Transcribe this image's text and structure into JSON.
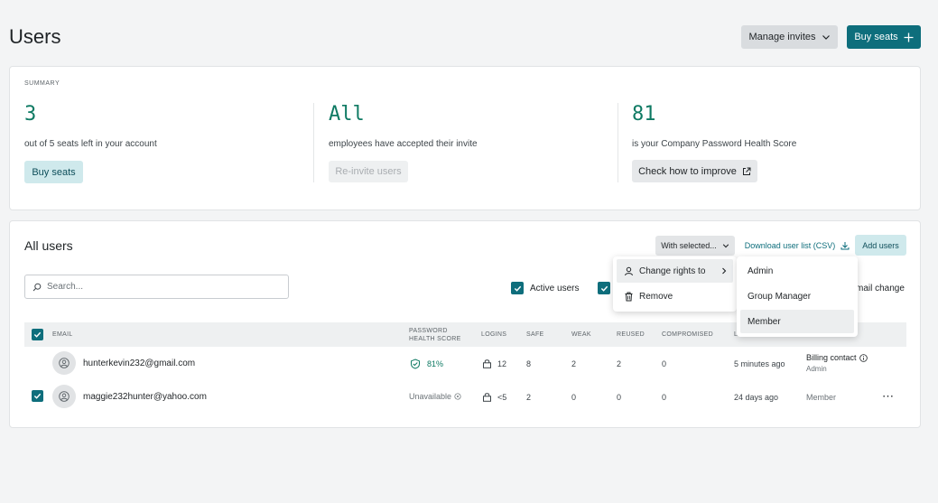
{
  "header": {
    "title": "Users",
    "manage_invites_label": "Manage invites",
    "buy_seats_label": "Buy seats"
  },
  "summary": {
    "label": "SUMMARY",
    "seats": {
      "value": "3",
      "text": "out of 5 seats left in your account",
      "button": "Buy seats"
    },
    "invites": {
      "value": "All",
      "text": "employees have accepted their invite",
      "button": "Re-invite users"
    },
    "health": {
      "value": "81",
      "text": "is your Company Password Health Score",
      "button": "Check how to improve"
    }
  },
  "all_users": {
    "title": "All users",
    "with_selected_label": "With selected...",
    "download_label": "Download user list (CSV)",
    "add_users_label": "Add users",
    "search_placeholder": "Search...",
    "filter_active_label": "Active users",
    "filter_email_change_label": "mail change",
    "columns": {
      "email": "EMAIL",
      "phs_line1": "PASSWORD",
      "phs_line2": "HEALTH SCORE",
      "logins": "LOGINS",
      "safe": "SAFE",
      "weak": "WEAK",
      "reused": "REUSED",
      "compromised": "COMPROMISED",
      "last_login": "L"
    },
    "rows": [
      {
        "email": "hunterkevin232@gmail.com",
        "health_score": "81%",
        "logins": "12",
        "safe": "8",
        "weak": "2",
        "reused": "2",
        "compromised": "0",
        "last_login": "5 minutes ago",
        "role_primary": "Billing contact",
        "role_secondary": "Admin"
      },
      {
        "email": "maggie232hunter@yahoo.com",
        "health_score": "Unavailable",
        "logins": "<5",
        "safe": "2",
        "weak": "0",
        "reused": "0",
        "compromised": "0",
        "last_login": "24 days ago",
        "role_primary": "Member",
        "more": "⋯"
      }
    ]
  },
  "context_menu": {
    "change_rights_label": "Change rights to",
    "remove_label": "Remove"
  },
  "submenu": {
    "items": [
      "Admin",
      "Group Manager",
      "Member"
    ],
    "highlighted": "Member"
  },
  "colors": {
    "teal": "#0e6e7c",
    "green": "#0e7a63",
    "background": "#f3f4f5"
  }
}
